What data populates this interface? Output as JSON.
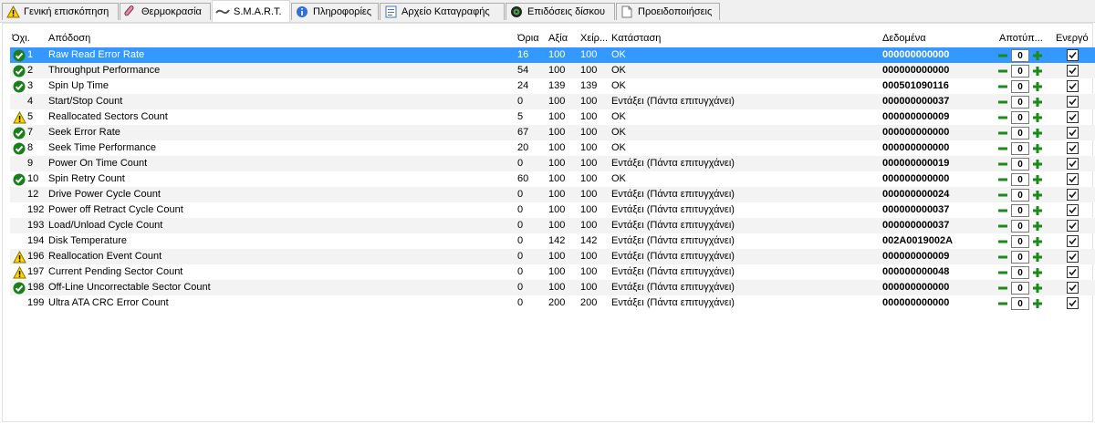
{
  "tabs": [
    {
      "label": "Γενική επισκόπηση",
      "icon": "warning-icon"
    },
    {
      "label": "Θερμοκρασία",
      "icon": "thermometer-icon"
    },
    {
      "label": "S.M.A.R.T.",
      "icon": "smart-wrench-icon",
      "active": true
    },
    {
      "label": "Πληροφορίες",
      "icon": "info-icon"
    },
    {
      "label": "Αρχείο Καταγραφής",
      "icon": "log-file-icon"
    },
    {
      "label": "Επιδόσεις δίσκου",
      "icon": "disk-performance-icon"
    },
    {
      "label": "Προειδοποιήσεις",
      "icon": "alerts-page-icon"
    }
  ],
  "headers": {
    "id": "Όχι.",
    "name": "Απόδοση",
    "threshold": "Όρια",
    "value": "Αξία",
    "worst": "Χείρ...",
    "status": "Κατάσταση",
    "data": "Δεδομένα",
    "offset": "Αποτύπ...",
    "enabled": "Ενεργό"
  },
  "rows": [
    {
      "icon": "ok",
      "id": "1",
      "name": "Raw Read Error Rate",
      "threshold": "16",
      "value": "100",
      "worst": "100",
      "status": "OK",
      "data": "000000000000",
      "offset": "0",
      "selected": true
    },
    {
      "icon": "ok",
      "id": "2",
      "name": "Throughput Performance",
      "threshold": "54",
      "value": "100",
      "worst": "100",
      "status": "OK",
      "data": "000000000000",
      "offset": "0"
    },
    {
      "icon": "ok",
      "id": "3",
      "name": "Spin Up Time",
      "threshold": "24",
      "value": "139",
      "worst": "139",
      "status": "OK",
      "data": "000501090116",
      "offset": "0"
    },
    {
      "icon": "none",
      "id": "4",
      "name": "Start/Stop Count",
      "threshold": "0",
      "value": "100",
      "worst": "100",
      "status": "Εντάξει (Πάντα επιτυγχάνει)",
      "data": "000000000037",
      "offset": "0"
    },
    {
      "icon": "warn",
      "id": "5",
      "name": "Reallocated Sectors Count",
      "threshold": "5",
      "value": "100",
      "worst": "100",
      "status": "OK",
      "data": "000000000009",
      "offset": "0"
    },
    {
      "icon": "ok",
      "id": "7",
      "name": "Seek Error Rate",
      "threshold": "67",
      "value": "100",
      "worst": "100",
      "status": "OK",
      "data": "000000000000",
      "offset": "0"
    },
    {
      "icon": "ok",
      "id": "8",
      "name": "Seek Time Performance",
      "threshold": "20",
      "value": "100",
      "worst": "100",
      "status": "OK",
      "data": "000000000000",
      "offset": "0"
    },
    {
      "icon": "none",
      "id": "9",
      "name": "Power On Time Count",
      "threshold": "0",
      "value": "100",
      "worst": "100",
      "status": "Εντάξει (Πάντα επιτυγχάνει)",
      "data": "000000000019",
      "offset": "0"
    },
    {
      "icon": "ok",
      "id": "10",
      "name": "Spin Retry Count",
      "threshold": "60",
      "value": "100",
      "worst": "100",
      "status": "OK",
      "data": "000000000000",
      "offset": "0"
    },
    {
      "icon": "none",
      "id": "12",
      "name": "Drive Power Cycle Count",
      "threshold": "0",
      "value": "100",
      "worst": "100",
      "status": "Εντάξει (Πάντα επιτυγχάνει)",
      "data": "000000000024",
      "offset": "0"
    },
    {
      "icon": "none",
      "id": "192",
      "name": "Power off Retract Cycle Count",
      "threshold": "0",
      "value": "100",
      "worst": "100",
      "status": "Εντάξει (Πάντα επιτυγχάνει)",
      "data": "000000000037",
      "offset": "0"
    },
    {
      "icon": "none",
      "id": "193",
      "name": "Load/Unload Cycle Count",
      "threshold": "0",
      "value": "100",
      "worst": "100",
      "status": "Εντάξει (Πάντα επιτυγχάνει)",
      "data": "000000000037",
      "offset": "0"
    },
    {
      "icon": "none",
      "id": "194",
      "name": "Disk Temperature",
      "threshold": "0",
      "value": "142",
      "worst": "142",
      "status": "Εντάξει (Πάντα επιτυγχάνει)",
      "data": "002A0019002A",
      "offset": "0"
    },
    {
      "icon": "warn",
      "id": "196",
      "name": "Reallocation Event Count",
      "threshold": "0",
      "value": "100",
      "worst": "100",
      "status": "Εντάξει (Πάντα επιτυγχάνει)",
      "data": "000000000009",
      "offset": "0"
    },
    {
      "icon": "warn",
      "id": "197",
      "name": "Current Pending Sector Count",
      "threshold": "0",
      "value": "100",
      "worst": "100",
      "status": "Εντάξει (Πάντα επιτυγχάνει)",
      "data": "000000000048",
      "offset": "0"
    },
    {
      "icon": "ok",
      "id": "198",
      "name": "Off-Line Uncorrectable Sector Count",
      "threshold": "0",
      "value": "100",
      "worst": "100",
      "status": "Εντάξει (Πάντα επιτυγχάνει)",
      "data": "000000000000",
      "offset": "0"
    },
    {
      "icon": "none",
      "id": "199",
      "name": "Ultra ATA CRC Error Count",
      "threshold": "0",
      "value": "200",
      "worst": "200",
      "status": "Εντάξει (Πάντα επιτυγχάνει)",
      "data": "000000000000",
      "offset": "0"
    }
  ],
  "colors": {
    "ok": "#1a7f1a",
    "warn": "#ffd700",
    "stepper": "#1b8a1b",
    "selection": "#3399ff",
    "alt_row": "#f3f3f3"
  }
}
